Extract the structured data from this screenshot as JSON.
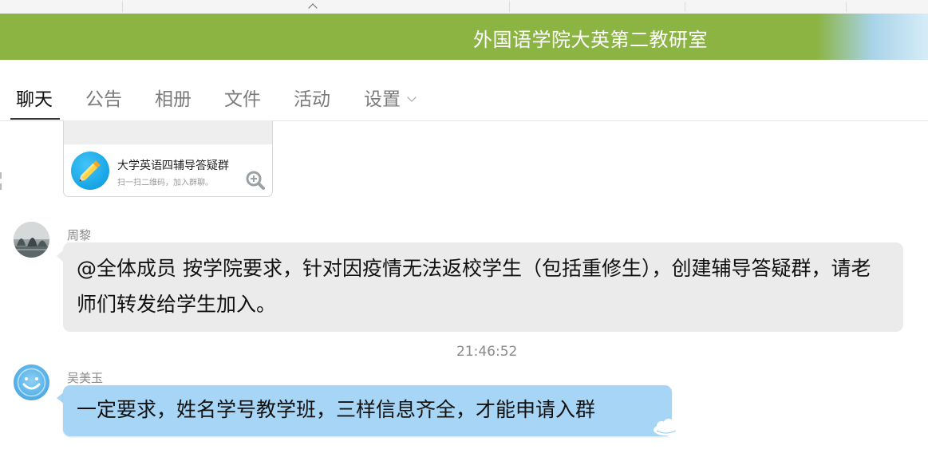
{
  "window": {
    "title": "外国语学院大英第二教研室"
  },
  "tabs": [
    {
      "label": "聊天",
      "active": true
    },
    {
      "label": "公告",
      "active": false
    },
    {
      "label": "相册",
      "active": false
    },
    {
      "label": "文件",
      "active": false
    },
    {
      "label": "活动",
      "active": false
    },
    {
      "label": "设置",
      "active": false,
      "has_dropdown": true
    }
  ],
  "group_card": {
    "name": "大学英语四辅导答疑群",
    "hint": "扫一扫二维码，加入群聊。",
    "icon": "pencil-icon",
    "action_icon": "zoom-in-icon"
  },
  "messages": [
    {
      "sender": "周黎",
      "avatar": "lake-photo-avatar",
      "text": "@全体成员 按学院要求，针对因疫情无法返校学生（包括重修生），创建辅导答疑群，请老师们转发给学生加入。",
      "bubble_color": "#ebebeb"
    },
    {
      "timestamp": "21:46:52"
    },
    {
      "sender": "吴美玉",
      "avatar": "smiley-avatar",
      "text": "一定要求，姓名学号教学班，三样信息齐全，才能申请入群",
      "bubble_color": "#a7d5f5"
    }
  ],
  "colors": {
    "title_bar": "#8bb443",
    "title_text": "#ffffff",
    "active_tab": "#111111",
    "inactive_tab": "#7b7b7b",
    "gray_bubble": "#ebebeb",
    "blue_bubble": "#a7d5f5"
  }
}
